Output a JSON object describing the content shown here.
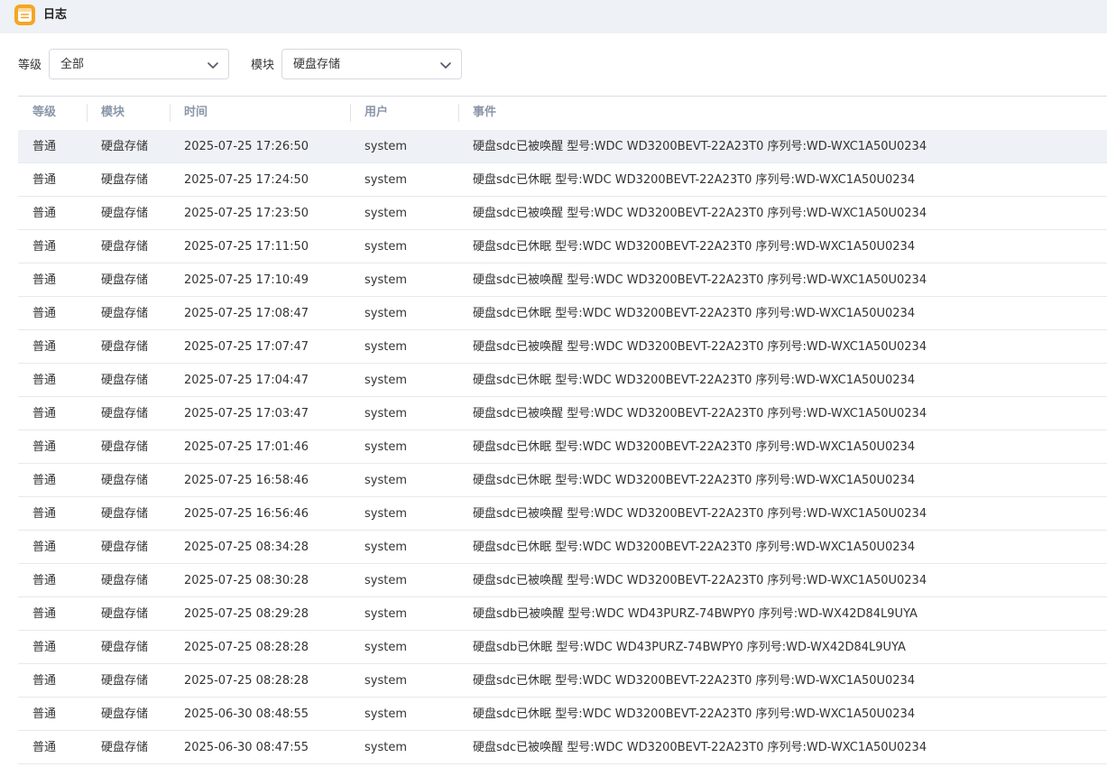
{
  "window": {
    "title": "日志",
    "icon": "calendar-list-icon",
    "accent": "#f5a623"
  },
  "filters": {
    "level_label": "等级",
    "level_value": "全部",
    "module_label": "模块",
    "module_value": "硬盘存储"
  },
  "table": {
    "columns": [
      "等级",
      "模块",
      "时间",
      "用户",
      "事件"
    ],
    "rows": [
      [
        "普通",
        "硬盘存储",
        "2025-07-25 17:26:50",
        "system",
        "硬盘sdc已被唤醒 型号:WDC WD3200BEVT-22A23T0 序列号:WD-WXC1A50U0234"
      ],
      [
        "普通",
        "硬盘存储",
        "2025-07-25 17:24:50",
        "system",
        "硬盘sdc已休眠 型号:WDC WD3200BEVT-22A23T0 序列号:WD-WXC1A50U0234"
      ],
      [
        "普通",
        "硬盘存储",
        "2025-07-25 17:23:50",
        "system",
        "硬盘sdc已被唤醒 型号:WDC WD3200BEVT-22A23T0 序列号:WD-WXC1A50U0234"
      ],
      [
        "普通",
        "硬盘存储",
        "2025-07-25 17:11:50",
        "system",
        "硬盘sdc已休眠 型号:WDC WD3200BEVT-22A23T0 序列号:WD-WXC1A50U0234"
      ],
      [
        "普通",
        "硬盘存储",
        "2025-07-25 17:10:49",
        "system",
        "硬盘sdc已被唤醒 型号:WDC WD3200BEVT-22A23T0 序列号:WD-WXC1A50U0234"
      ],
      [
        "普通",
        "硬盘存储",
        "2025-07-25 17:08:47",
        "system",
        "硬盘sdc已休眠 型号:WDC WD3200BEVT-22A23T0 序列号:WD-WXC1A50U0234"
      ],
      [
        "普通",
        "硬盘存储",
        "2025-07-25 17:07:47",
        "system",
        "硬盘sdc已被唤醒 型号:WDC WD3200BEVT-22A23T0 序列号:WD-WXC1A50U0234"
      ],
      [
        "普通",
        "硬盘存储",
        "2025-07-25 17:04:47",
        "system",
        "硬盘sdc已休眠 型号:WDC WD3200BEVT-22A23T0 序列号:WD-WXC1A50U0234"
      ],
      [
        "普通",
        "硬盘存储",
        "2025-07-25 17:03:47",
        "system",
        "硬盘sdc已被唤醒 型号:WDC WD3200BEVT-22A23T0 序列号:WD-WXC1A50U0234"
      ],
      [
        "普通",
        "硬盘存储",
        "2025-07-25 17:01:46",
        "system",
        "硬盘sdc已休眠 型号:WDC WD3200BEVT-22A23T0 序列号:WD-WXC1A50U0234"
      ],
      [
        "普通",
        "硬盘存储",
        "2025-07-25 16:58:46",
        "system",
        "硬盘sdc已休眠 型号:WDC WD3200BEVT-22A23T0 序列号:WD-WXC1A50U0234"
      ],
      [
        "普通",
        "硬盘存储",
        "2025-07-25 16:56:46",
        "system",
        "硬盘sdc已被唤醒 型号:WDC WD3200BEVT-22A23T0 序列号:WD-WXC1A50U0234"
      ],
      [
        "普通",
        "硬盘存储",
        "2025-07-25 08:34:28",
        "system",
        "硬盘sdc已休眠 型号:WDC WD3200BEVT-22A23T0 序列号:WD-WXC1A50U0234"
      ],
      [
        "普通",
        "硬盘存储",
        "2025-07-25 08:30:28",
        "system",
        "硬盘sdc已被唤醒 型号:WDC WD3200BEVT-22A23T0 序列号:WD-WXC1A50U0234"
      ],
      [
        "普通",
        "硬盘存储",
        "2025-07-25 08:29:28",
        "system",
        "硬盘sdb已被唤醒 型号:WDC WD43PURZ-74BWPY0 序列号:WD-WX42D84L9UYA"
      ],
      [
        "普通",
        "硬盘存储",
        "2025-07-25 08:28:28",
        "system",
        "硬盘sdb已休眠 型号:WDC WD43PURZ-74BWPY0 序列号:WD-WX42D84L9UYA"
      ],
      [
        "普通",
        "硬盘存储",
        "2025-07-25 08:28:28",
        "system",
        "硬盘sdc已休眠 型号:WDC WD3200BEVT-22A23T0 序列号:WD-WXC1A50U0234"
      ],
      [
        "普通",
        "硬盘存储",
        "2025-06-30 08:48:55",
        "system",
        "硬盘sdc已休眠 型号:WDC WD3200BEVT-22A23T0 序列号:WD-WXC1A50U0234"
      ],
      [
        "普通",
        "硬盘存储",
        "2025-06-30 08:47:55",
        "system",
        "硬盘sdc已被唤醒 型号:WDC WD3200BEVT-22A23T0 序列号:WD-WXC1A50U0234"
      ]
    ]
  }
}
